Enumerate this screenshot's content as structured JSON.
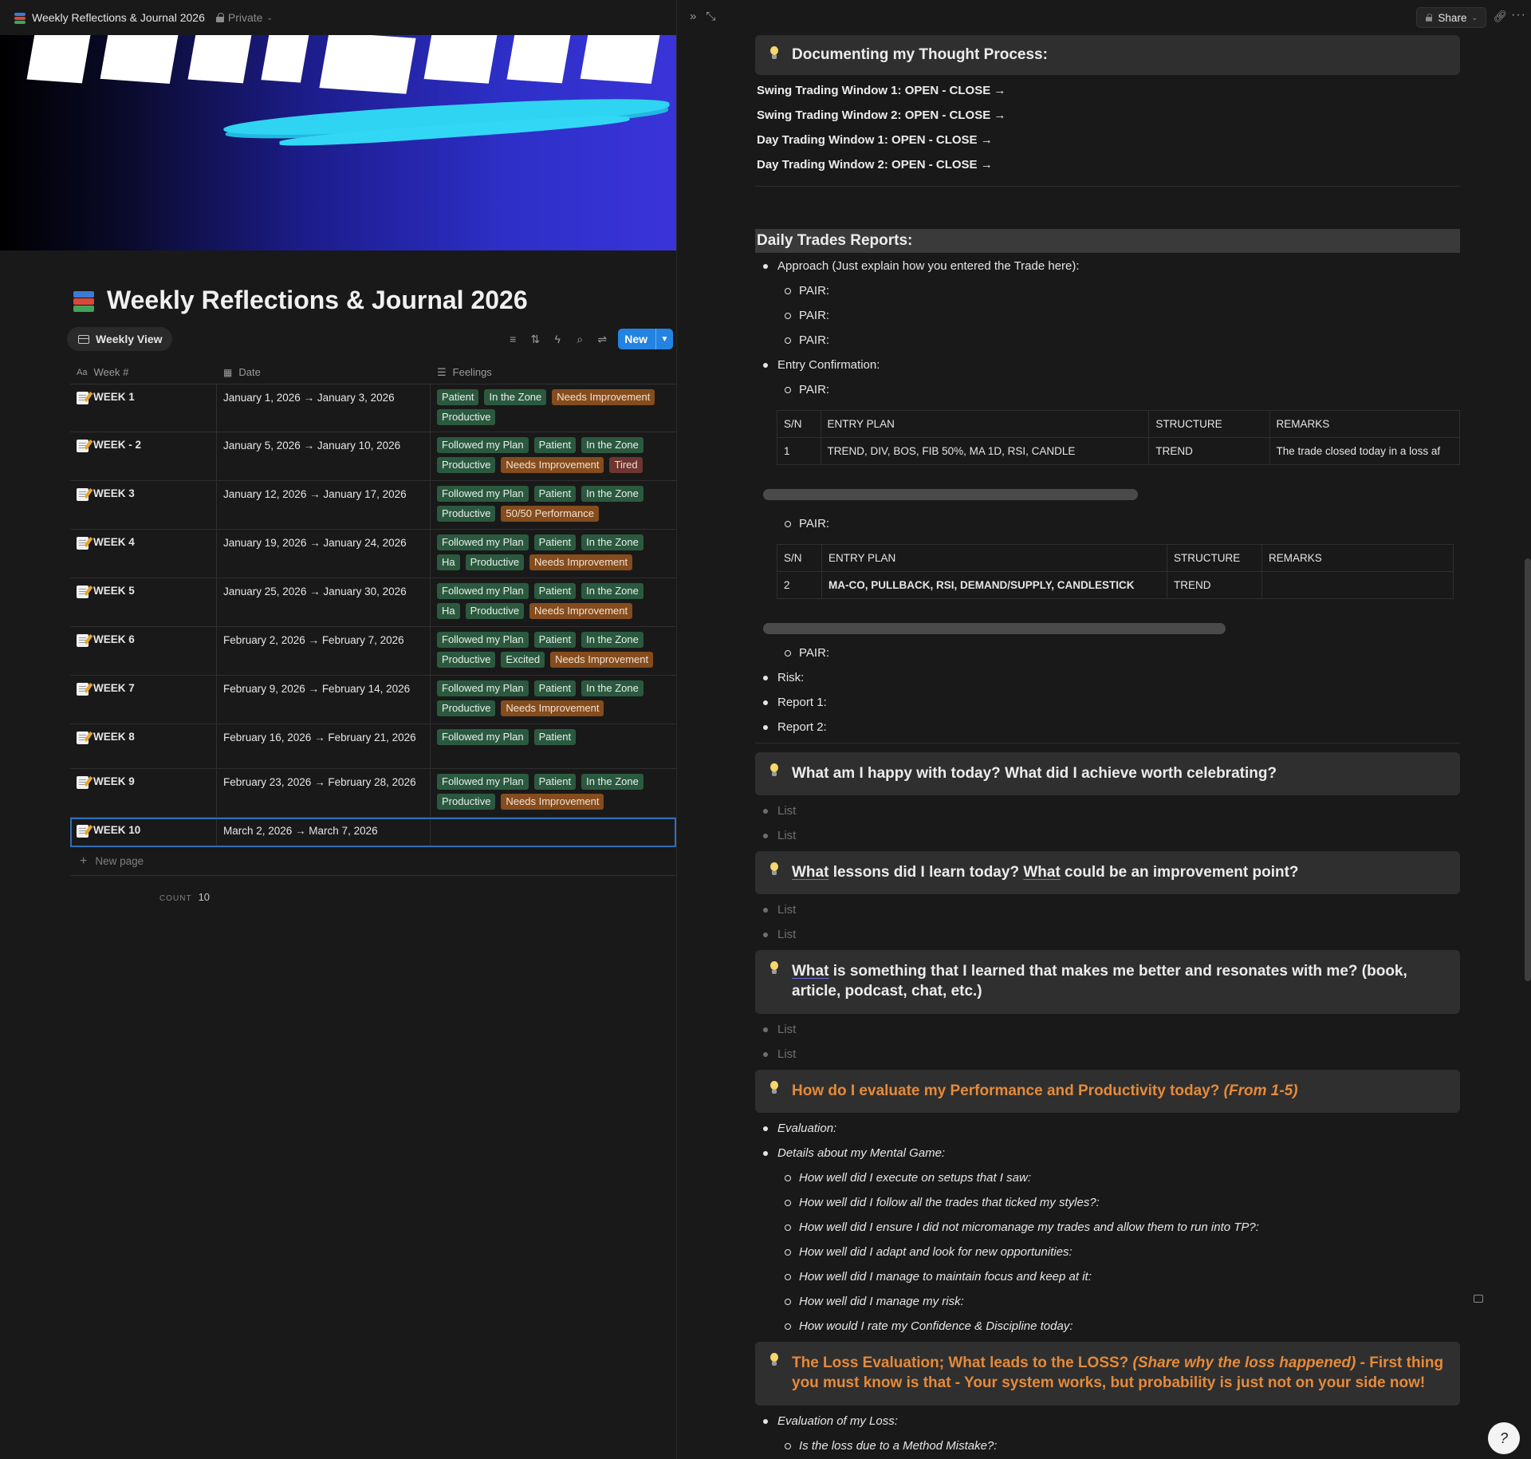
{
  "window": {
    "title": "Weekly Reflections & Journal 2026",
    "privacy": "Private",
    "share_label": "Share",
    "icons": [
      "books-icon",
      "lock-icon",
      "expand-icon",
      "link-icon",
      "more-icon"
    ]
  },
  "database": {
    "title": "Weekly Reflections & Journal 2026",
    "view_tab": "Weekly View",
    "new_label": "New",
    "columns": {
      "name": "Week #",
      "date": "Date",
      "feelings": "Feelings"
    },
    "rows": [
      {
        "week": "WEEK 1",
        "date": "January 1, 2026 → January 3, 2026",
        "tags": [
          [
            "Patient",
            "green"
          ],
          [
            "In the Zone",
            "green"
          ],
          [
            "Needs Improvement",
            "orange"
          ],
          [
            "Productive",
            "green"
          ]
        ]
      },
      {
        "week": "WEEK - 2",
        "date": "January 5, 2026 → January 10, 2026",
        "tags": [
          [
            "Followed my Plan",
            "green"
          ],
          [
            "Patient",
            "green"
          ],
          [
            "In the Zone",
            "green"
          ],
          [
            "Productive",
            "green"
          ],
          [
            "Needs Improvement",
            "orange"
          ],
          [
            "Tired",
            "red"
          ]
        ]
      },
      {
        "week": "WEEK 3",
        "date": "January 12, 2026 → January 17, 2026",
        "tags": [
          [
            "Followed my Plan",
            "green"
          ],
          [
            "Patient",
            "green"
          ],
          [
            "In the Zone",
            "green"
          ],
          [
            "Productive",
            "green"
          ],
          [
            "50/50 Performance",
            "orange"
          ]
        ]
      },
      {
        "week": "WEEK 4",
        "date": "January 19, 2026 → January 24, 2026",
        "tags": [
          [
            "Followed my Plan",
            "green"
          ],
          [
            "Patient",
            "green"
          ],
          [
            "In the Zone",
            "green"
          ],
          [
            "Ha",
            "green"
          ],
          [
            "Productive",
            "green"
          ],
          [
            "Needs Improvement",
            "orange"
          ]
        ]
      },
      {
        "week": "WEEK 5",
        "date": "January 25, 2026 → January 30, 2026",
        "tags": [
          [
            "Followed my Plan",
            "green"
          ],
          [
            "Patient",
            "green"
          ],
          [
            "In the Zone",
            "green"
          ],
          [
            "Ha",
            "green"
          ],
          [
            "Productive",
            "green"
          ],
          [
            "Needs Improvement",
            "orange"
          ]
        ]
      },
      {
        "week": "WEEK 6",
        "date": "February 2, 2026 → February 7, 2026",
        "tags": [
          [
            "Followed my Plan",
            "green"
          ],
          [
            "Patient",
            "green"
          ],
          [
            "In the Zone",
            "green"
          ],
          [
            "Productive",
            "green"
          ],
          [
            "Excited",
            "green"
          ],
          [
            "Needs Improvement",
            "orange"
          ]
        ]
      },
      {
        "week": "WEEK 7",
        "date": "February 9, 2026 → February 14, 2026",
        "tags": [
          [
            "Followed my Plan",
            "green"
          ],
          [
            "Patient",
            "green"
          ],
          [
            "In the Zone",
            "green"
          ],
          [
            "Productive",
            "green"
          ],
          [
            "Needs Improvement",
            "orange"
          ]
        ]
      },
      {
        "week": "WEEK 8",
        "date": "February 16, 2026 → February 21, 2026",
        "tags": [
          [
            "Followed my Plan",
            "green"
          ],
          [
            "Patient",
            "green"
          ]
        ]
      },
      {
        "week": "WEEK 9",
        "date": "February 23, 2026 → February 28, 2026",
        "tags": [
          [
            "Followed my Plan",
            "green"
          ],
          [
            "Patient",
            "green"
          ],
          [
            "In the Zone",
            "green"
          ],
          [
            "Productive",
            "green"
          ],
          [
            "Needs Improvement",
            "orange"
          ]
        ]
      },
      {
        "week": "WEEK 10",
        "date": "March 2, 2026 → March 7, 2026",
        "tags": []
      }
    ],
    "new_page": "New page",
    "count_label": "COUNT",
    "count_value": "10"
  },
  "doc": {
    "thought_callout": "Documenting my Thought Process:",
    "windows": [
      "Swing Trading Window 1: OPEN - CLOSE →",
      "Swing Trading Window 2: OPEN - CLOSE →",
      "Day Trading Window 1: OPEN - CLOSE →",
      "Day Trading Window 2: OPEN - CLOSE →"
    ],
    "reports_heading": "Daily Trades Reports:",
    "approach": "Approach (Just explain how you entered the Trade here):",
    "pair": "PAIR:",
    "entry_confirmation": "Entry Confirmation:",
    "table_headers": [
      "S/N",
      "ENTRY PLAN",
      "STRUCTURE",
      "REMARKS"
    ],
    "table1_row": [
      "1",
      "TREND, DIV, BOS, FIB 50%, MA 1D, RSI, CANDLE",
      "TREND",
      "The trade closed today in a loss af"
    ],
    "table2_row": [
      "2",
      "MA-CO, PULLBACK, RSI, DEMAND/SUPPLY, CANDLESTICK",
      "TREND",
      ""
    ],
    "risk": "Risk:",
    "report1": "Report 1:",
    "report2": "Report 2:",
    "happy_callout": "What am I happy with today? What did I achieve worth celebrating?",
    "list_placeholder": "List",
    "lessons_a": "What",
    "lessons_b": " lessons did I learn today? ",
    "lessons_c": "What",
    "lessons_d": " could be an improvement point?",
    "learned_a": "What",
    "learned_b": " is something that I learned that makes me better and resonates with me? (book, article, podcast, chat, etc.)",
    "eval_callout_a": "How do I evaluate my Performance and Productivity today? ",
    "eval_callout_b": "(From 1-5)",
    "evaluation": "Evaluation:",
    "mental_game": "Details about my Mental Game:",
    "mental_items": [
      "How well did I execute on setups that I saw:",
      "How well did I follow all the trades that ticked my styles?:",
      "How well did I ensure I did not micromanage my trades and allow them to run into TP?:",
      "How well did I adapt and look for new opportunities:",
      "How well did I manage to maintain focus and keep at it:",
      "How well did I manage my risk:",
      "How would I rate my Confidence & Discipline today:"
    ],
    "loss_callout_a": "The Loss Evaluation; What leads to the LOSS? ",
    "loss_callout_b": "(Share why the loss happened)",
    "loss_callout_c": " - First thing you must know is that - Your system works, but probability is just not on your side now!",
    "loss_eval": "Evaluation of my Loss:",
    "loss_q1": "Is the loss due to a Method Mistake?:"
  }
}
